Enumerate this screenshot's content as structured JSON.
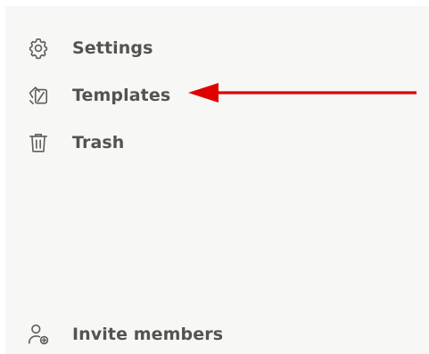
{
  "sidebar": {
    "items": [
      {
        "id": "settings",
        "label": "Settings",
        "icon": "gear-icon"
      },
      {
        "id": "templates",
        "label": "Templates",
        "icon": "templates-icon"
      },
      {
        "id": "trash",
        "label": "Trash",
        "icon": "trash-icon"
      }
    ],
    "footer": {
      "invite_label": "Invite members",
      "invite_icon": "user-plus-icon"
    }
  },
  "annotation": {
    "arrow_color": "#e00000",
    "points_to": "templates"
  },
  "colors": {
    "sidebar_bg": "#f7f7f5",
    "text": "#55534e",
    "icon": "#5f5e5b"
  }
}
